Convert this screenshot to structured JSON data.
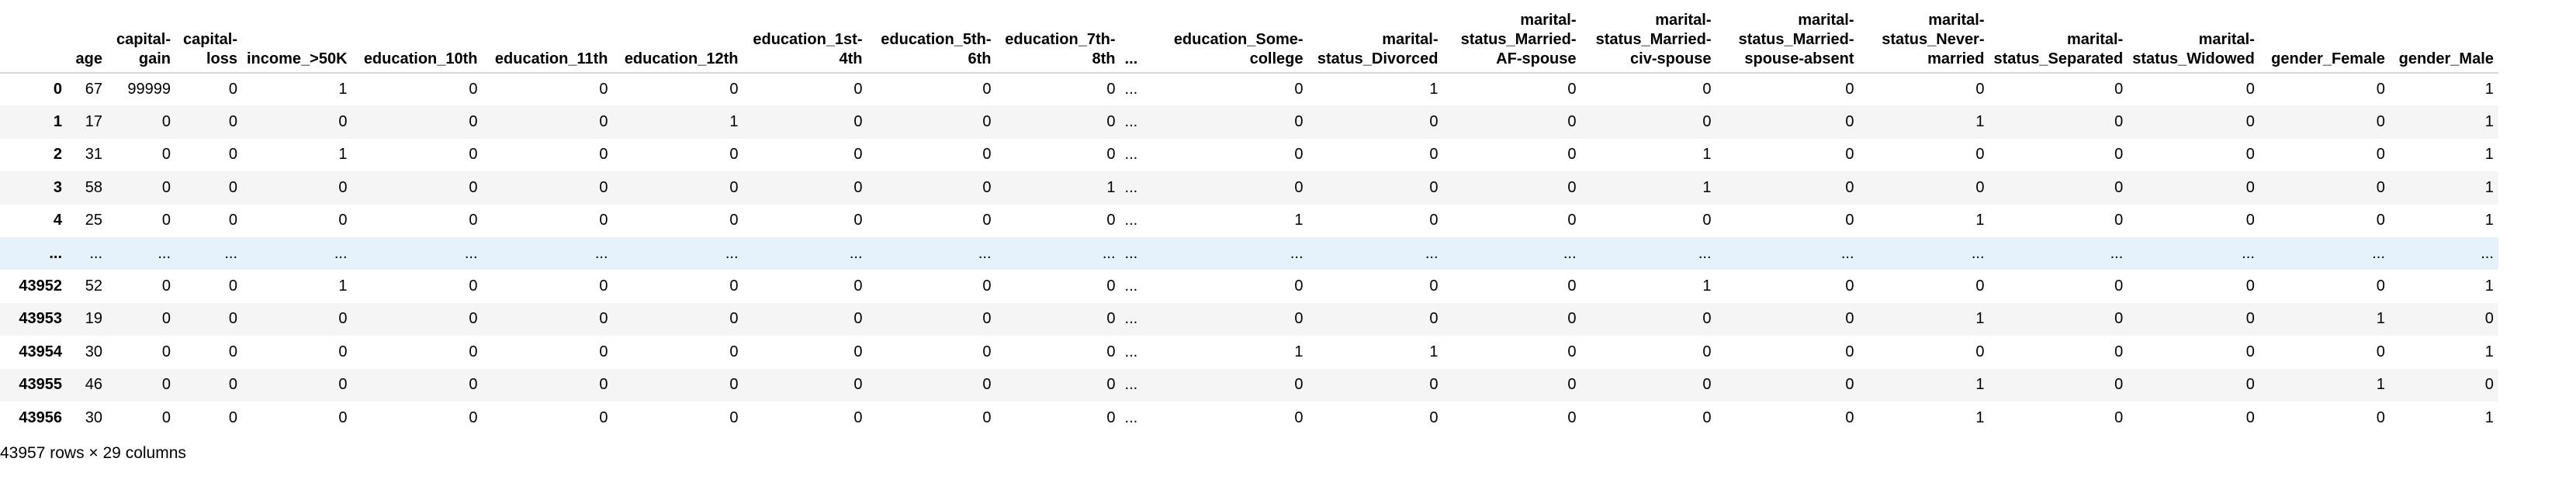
{
  "table": {
    "columns": [
      "",
      "age",
      "capital-\ngain",
      "capital-\nloss",
      "income_>50K",
      "education_10th",
      "education_11th",
      "education_12th",
      "education_1st-\n4th",
      "education_5th-\n6th",
      "education_7th-\n8th",
      "...",
      "education_Some-\ncollege",
      "marital-\nstatus_Divorced",
      "marital-\nstatus_Married-\nAF-spouse",
      "marital-\nstatus_Married-\nciv-spouse",
      "marital-\nstatus_Married-\nspouse-absent",
      "marital-\nstatus_Never-\nmarried",
      "marital-\nstatus_Separated",
      "marital-\nstatus_Widowed",
      "gender_Female",
      "gender_Male"
    ],
    "rows": [
      {
        "index": "0",
        "cells": [
          "67",
          "99999",
          "0",
          "1",
          "0",
          "0",
          "0",
          "0",
          "0",
          "0",
          "...",
          "0",
          "1",
          "0",
          "0",
          "0",
          "0",
          "0",
          "0",
          "0",
          "1"
        ]
      },
      {
        "index": "1",
        "cells": [
          "17",
          "0",
          "0",
          "0",
          "0",
          "0",
          "1",
          "0",
          "0",
          "0",
          "...",
          "0",
          "0",
          "0",
          "0",
          "0",
          "1",
          "0",
          "0",
          "0",
          "1"
        ]
      },
      {
        "index": "2",
        "cells": [
          "31",
          "0",
          "0",
          "1",
          "0",
          "0",
          "0",
          "0",
          "0",
          "0",
          "...",
          "0",
          "0",
          "0",
          "1",
          "0",
          "0",
          "0",
          "0",
          "0",
          "1"
        ]
      },
      {
        "index": "3",
        "cells": [
          "58",
          "0",
          "0",
          "0",
          "0",
          "0",
          "0",
          "0",
          "0",
          "1",
          "...",
          "0",
          "0",
          "0",
          "1",
          "0",
          "0",
          "0",
          "0",
          "0",
          "1"
        ]
      },
      {
        "index": "4",
        "cells": [
          "25",
          "0",
          "0",
          "0",
          "0",
          "0",
          "0",
          "0",
          "0",
          "0",
          "...",
          "1",
          "0",
          "0",
          "0",
          "0",
          "1",
          "0",
          "0",
          "0",
          "1"
        ]
      },
      {
        "index": "...",
        "ellipsis": true,
        "cells": [
          "...",
          "...",
          "...",
          "...",
          "...",
          "...",
          "...",
          "...",
          "...",
          "...",
          "...",
          "...",
          "...",
          "...",
          "...",
          "...",
          "...",
          "...",
          "...",
          "...",
          "..."
        ]
      },
      {
        "index": "43952",
        "cells": [
          "52",
          "0",
          "0",
          "1",
          "0",
          "0",
          "0",
          "0",
          "0",
          "0",
          "...",
          "0",
          "0",
          "0",
          "1",
          "0",
          "0",
          "0",
          "0",
          "0",
          "1"
        ]
      },
      {
        "index": "43953",
        "cells": [
          "19",
          "0",
          "0",
          "0",
          "0",
          "0",
          "0",
          "0",
          "0",
          "0",
          "...",
          "0",
          "0",
          "0",
          "0",
          "0",
          "1",
          "0",
          "0",
          "1",
          "0"
        ]
      },
      {
        "index": "43954",
        "cells": [
          "30",
          "0",
          "0",
          "0",
          "0",
          "0",
          "0",
          "0",
          "0",
          "0",
          "...",
          "1",
          "1",
          "0",
          "0",
          "0",
          "0",
          "0",
          "0",
          "0",
          "1"
        ]
      },
      {
        "index": "43955",
        "cells": [
          "46",
          "0",
          "0",
          "0",
          "0",
          "0",
          "0",
          "0",
          "0",
          "0",
          "...",
          "0",
          "0",
          "0",
          "0",
          "0",
          "1",
          "0",
          "0",
          "1",
          "0"
        ]
      },
      {
        "index": "43956",
        "cells": [
          "30",
          "0",
          "0",
          "0",
          "0",
          "0",
          "0",
          "0",
          "0",
          "0",
          "...",
          "0",
          "0",
          "0",
          "0",
          "0",
          "1",
          "0",
          "0",
          "0",
          "1"
        ]
      }
    ]
  },
  "footer": {
    "shape_text": "43957 rows × 29 columns"
  }
}
